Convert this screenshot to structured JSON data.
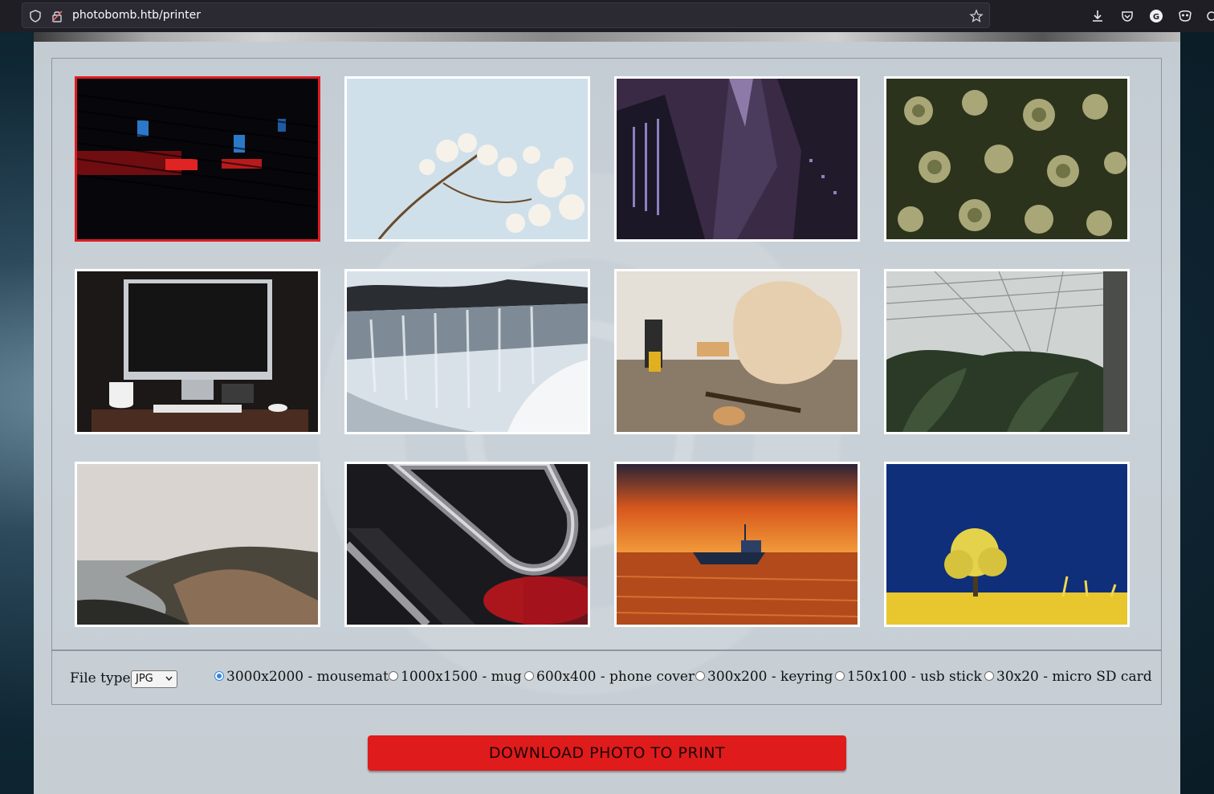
{
  "browser": {
    "url": "photobomb.htb/printer"
  },
  "gallery": {
    "photos": [
      {
        "subject": "red and blue neon light bars",
        "selected": true
      },
      {
        "subject": "white blossoms against sky",
        "selected": false
      },
      {
        "subject": "skyscrapers from below at night",
        "selected": false
      },
      {
        "subject": "green succulent leaves",
        "selected": false
      },
      {
        "subject": "desktop computer on desk",
        "selected": false
      },
      {
        "subject": "frozen waterfall",
        "selected": false
      },
      {
        "subject": "workbench with guitar bodies and tools",
        "selected": false
      },
      {
        "subject": "greenhouse interior",
        "selected": false
      },
      {
        "subject": "foggy coastline",
        "selected": false
      },
      {
        "subject": "chrome curved shapes with red light",
        "selected": false
      },
      {
        "subject": "boat at sunset",
        "selected": false
      },
      {
        "subject": "yellow tree in field under blue sky",
        "selected": false
      }
    ]
  },
  "options": {
    "filetype_label": "File type",
    "filetype_value": "JPG",
    "sizes": [
      {
        "label": "3000x2000 - mousemat",
        "checked": true
      },
      {
        "label": "1000x1500 - mug",
        "checked": false
      },
      {
        "label": "600x400 - phone cover",
        "checked": false
      },
      {
        "label": "300x200 - keyring",
        "checked": false
      },
      {
        "label": "150x100 - usb stick",
        "checked": false
      },
      {
        "label": "30x20 - micro SD card",
        "checked": false
      }
    ]
  },
  "download_button": "DOWNLOAD PHOTO TO PRINT",
  "colors": {
    "accent_red": "#e01b1b",
    "selected_border": "#e01b24",
    "radio_blue": "#3584e4"
  }
}
